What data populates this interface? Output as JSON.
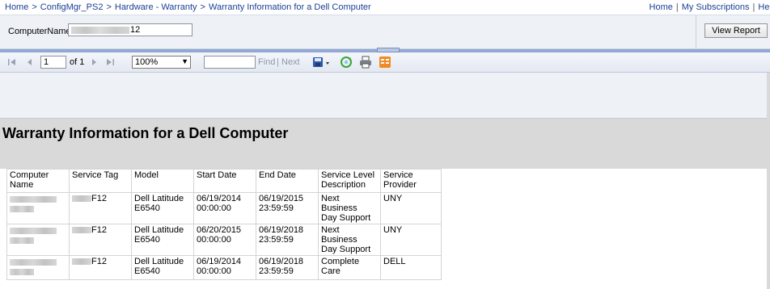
{
  "breadcrumb": {
    "items": [
      "Home",
      "ConfigMgr_PS2",
      "Hardware - Warranty",
      "Warranty Information for a Dell Computer"
    ],
    "separator": ">"
  },
  "top_links": [
    "Home",
    "My Subscriptions",
    "Help"
  ],
  "parameters": {
    "computer_name_label": "ComputerName",
    "computer_name_value_visible": "12",
    "view_report_label": "View Report"
  },
  "toolbar": {
    "first_page_icon": "first-page-icon",
    "prev_page_icon": "previous-page-icon",
    "page_number": "1",
    "page_of": "of 1",
    "next_page_icon": "next-page-icon",
    "last_page_icon": "last-page-icon",
    "zoom": "100%",
    "find_label": "Find",
    "find_separator": "|",
    "next_label": "Next",
    "export_icon": "save-export-icon",
    "refresh_icon": "refresh-icon",
    "print_icon": "print-icon",
    "feed_icon": "data-feed-icon"
  },
  "report": {
    "title": "Warranty Information for a Dell Computer",
    "columns": [
      {
        "line1": "Computer",
        "line2": "Name"
      },
      {
        "line1": "Service Tag",
        "line2": ""
      },
      {
        "line1": "Model",
        "line2": ""
      },
      {
        "line1": "Start Date",
        "line2": ""
      },
      {
        "line1": "End Date",
        "line2": ""
      },
      {
        "line1": "Service Level",
        "line2": "Description"
      },
      {
        "line1": "Service",
        "line2": "Provider"
      }
    ],
    "rows": [
      {
        "service_tag_suffix": "F12",
        "model1": "Dell Latitude",
        "model2": "E6540",
        "start1": "06/19/2014",
        "start2": "00:00:00",
        "end1": "06/19/2015",
        "end2": "23:59:59",
        "level1": "Next Business",
        "level2": "Day Support",
        "provider": "UNY"
      },
      {
        "service_tag_suffix": "F12",
        "model1": "Dell Latitude",
        "model2": "E6540",
        "start1": "06/20/2015",
        "start2": "00:00:00",
        "end1": "06/19/2018",
        "end2": "23:59:59",
        "level1": "Next Business",
        "level2": "Day Support",
        "provider": "UNY"
      },
      {
        "service_tag_suffix": "F12",
        "model1": "Dell Latitude",
        "model2": "E6540",
        "start1": "06/19/2014",
        "start2": "00:00:00",
        "end1": "06/19/2018",
        "end2": "23:59:59",
        "level1": "Complete Care",
        "level2": "",
        "provider": "DELL"
      }
    ]
  },
  "colors": {
    "link": "#1c3f94",
    "param_bg": "#eef1f6",
    "title_band": "#d9d9d9",
    "collapse_strip": "#8fa8d4"
  }
}
